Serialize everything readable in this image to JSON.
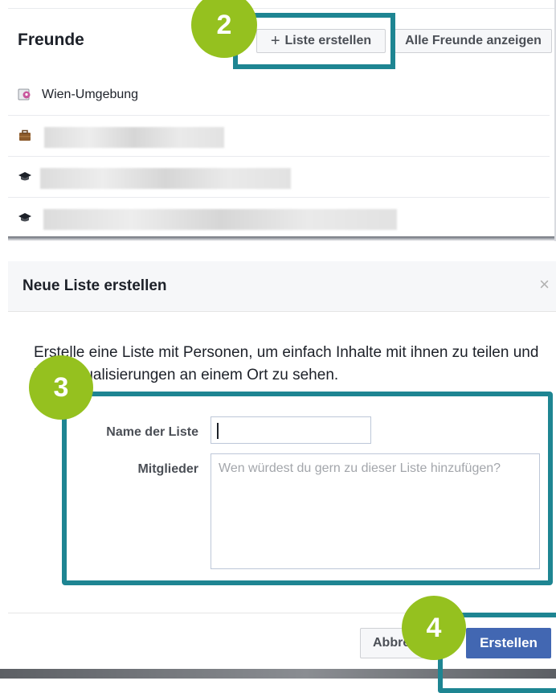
{
  "friends_panel": {
    "title": "Freunde",
    "create_list_button": "Liste erstellen",
    "all_friends_button": "Alle Freunde anzeigen",
    "lists": [
      {
        "icon": "location-pin-icon",
        "label": "Wien-Umgebung"
      },
      {
        "icon": "briefcase-icon",
        "label": ""
      },
      {
        "icon": "graduation-cap-icon",
        "label": ""
      },
      {
        "icon": "graduation-cap-icon",
        "label": ""
      }
    ]
  },
  "modal": {
    "title": "Neue Liste erstellen",
    "close_symbol": "×",
    "intro_text": "Erstelle eine Liste mit Personen, um einfach Inhalte mit ihnen zu teilen und ihre Aktualisierungen an einem Ort zu sehen.",
    "name_label": "Name der Liste",
    "name_value": "",
    "members_label": "Mitglieder",
    "members_placeholder": "Wen würdest du gern zu dieser Liste hinzufügen?",
    "cancel_button": "Abbrechen",
    "submit_button": "Erstellen"
  },
  "annotations": {
    "step_2": "2",
    "step_3": "3",
    "step_4": "4",
    "highlight_color": "#1e8592",
    "badge_color": "#95c11f"
  },
  "colors": {
    "primary_button": "#4267b2"
  }
}
